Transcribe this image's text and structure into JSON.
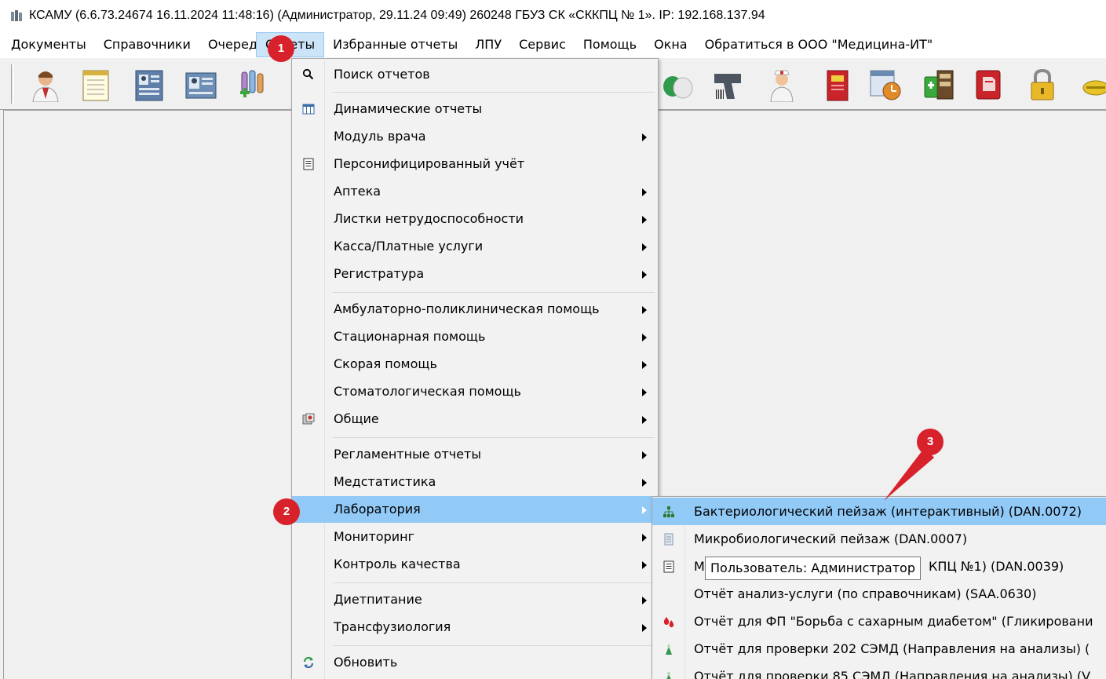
{
  "window": {
    "title": "КСАМУ (6.6.73.24674 16.11.2024 11:48:16) (Администратор, 29.11.24 09:49)  260248 ГБУЗ СК «СККПЦ № 1». IP: 192.168.137.94"
  },
  "menubar": {
    "items": [
      {
        "label": "Документы"
      },
      {
        "label": "Справочники"
      },
      {
        "label": "Очеред"
      },
      {
        "label": "Отчеты"
      },
      {
        "label": "Избранные отчеты"
      },
      {
        "label": "ЛПУ"
      },
      {
        "label": "Сервис"
      },
      {
        "label": "Помощь"
      },
      {
        "label": "Окна"
      },
      {
        "label": "Обратиться в ООО \"Медицина-ИТ\""
      }
    ]
  },
  "reports_menu": {
    "items": [
      {
        "label": "Поиск отчетов",
        "icon": "search-icon"
      },
      {
        "label": "Динамические отчеты",
        "icon": "table-icon"
      },
      {
        "label": "Модуль врача",
        "submenu": true
      },
      {
        "label": "Персонифицированный учёт",
        "icon": "document-icon"
      },
      {
        "label": "Аптека",
        "submenu": true
      },
      {
        "label": "Листки нетрудоспособности",
        "submenu": true
      },
      {
        "label": "Касса/Платные услуги",
        "submenu": true
      },
      {
        "label": "Регистратура",
        "submenu": true
      },
      {
        "label": "Амбулаторно-поликлиническая помощь",
        "submenu": true
      },
      {
        "label": "Стационарная помощь",
        "submenu": true
      },
      {
        "label": "Скорая помощь",
        "submenu": true
      },
      {
        "label": "Стоматологическая помощь",
        "submenu": true
      },
      {
        "label": "Общие",
        "submenu": true,
        "icon": "general-icon"
      },
      {
        "label": "Регламентные отчеты",
        "submenu": true
      },
      {
        "label": "Медстатистика",
        "submenu": true
      },
      {
        "label": "Лаборатория",
        "submenu": true,
        "highlighted": true
      },
      {
        "label": "Мониторинг",
        "submenu": true
      },
      {
        "label": "Контроль качества",
        "submenu": true
      },
      {
        "label": "Диетпитание",
        "submenu": true
      },
      {
        "label": "Трансфузиология",
        "submenu": true
      },
      {
        "label": "Обновить",
        "icon": "refresh-icon"
      }
    ]
  },
  "lab_menu": {
    "items": [
      {
        "label": "Бактериологический пейзаж (интерактивный) (DAN.0072)",
        "icon": "network-icon",
        "highlighted": true
      },
      {
        "label": "Микробиологический пейзаж (DAN.0007)",
        "icon": "page-icon"
      },
      {
        "label": "М",
        "label_tail": "КПЦ  №1) (DAN.0039)",
        "icon": "document-icon"
      },
      {
        "label": "Отчёт анализ-услуги (по справочникам) (SAA.0630)"
      },
      {
        "label": "Отчёт для ФП \"Борьба с сахарным диабетом\" (Гликировани",
        "icon": "blood-drops-icon"
      },
      {
        "label": "Отчёт для проверки 202 СЭМД (Направления на анализы) (",
        "icon": "flask-icon"
      },
      {
        "label": "Отчёт для проверки 85 СЭМД (Направления на анализы) (V",
        "icon": "flask-icon"
      }
    ]
  },
  "tooltip": {
    "text": "Пользователь: Администратор"
  },
  "annotations": {
    "step1": "1",
    "step2": "2",
    "step3": "3"
  },
  "colors": {
    "highlight": "#91c9f7",
    "menu_active": "#cce4f7",
    "badge": "#d8222b"
  }
}
